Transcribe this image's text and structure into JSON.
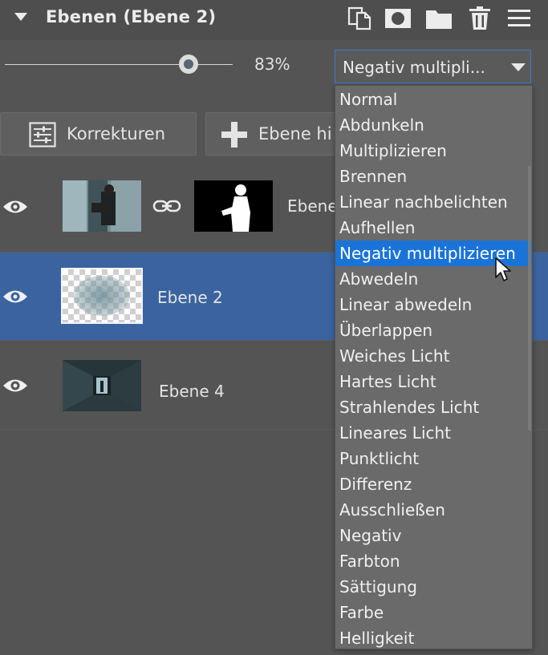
{
  "panel": {
    "title": "Ebenen (Ebene 2)",
    "header_icons": [
      "duplicate-layer-icon",
      "mask-icon",
      "folder-icon",
      "trash-icon",
      "menu-icon"
    ]
  },
  "opacity": {
    "value": 83,
    "label": "83%"
  },
  "blend_mode": {
    "selected": "Negativ multiplizieren",
    "selected_display": "Negativ multipli...",
    "options": [
      "Normal",
      "Abdunkeln",
      "Multiplizieren",
      "Brennen",
      "Linear nachbelichten",
      "Aufhellen",
      "Negativ multiplizieren",
      "Abwedeln",
      "Linear abwedeln",
      "Überlappen",
      "Weiches Licht",
      "Hartes Licht",
      "Strahlendes Licht",
      "Lineares Licht",
      "Punktlicht",
      "Differenz",
      "Ausschließen",
      "Negativ",
      "Farbton",
      "Sättigung",
      "Farbe",
      "Helligkeit"
    ]
  },
  "buttons": {
    "corrections": "Korrekturen",
    "add_layer": "Ebene hi"
  },
  "layers": [
    {
      "name": "Ebene",
      "visible": true,
      "has_mask": true
    },
    {
      "name": "Ebene 2",
      "visible": true,
      "selected": true
    },
    {
      "name": "Ebene 4",
      "visible": true
    }
  ],
  "colors": {
    "panel_bg": "#545454",
    "selected_row": "#3a63a0",
    "dropdown_highlight": "#1a73d8",
    "select_border": "#3d7ad0"
  }
}
